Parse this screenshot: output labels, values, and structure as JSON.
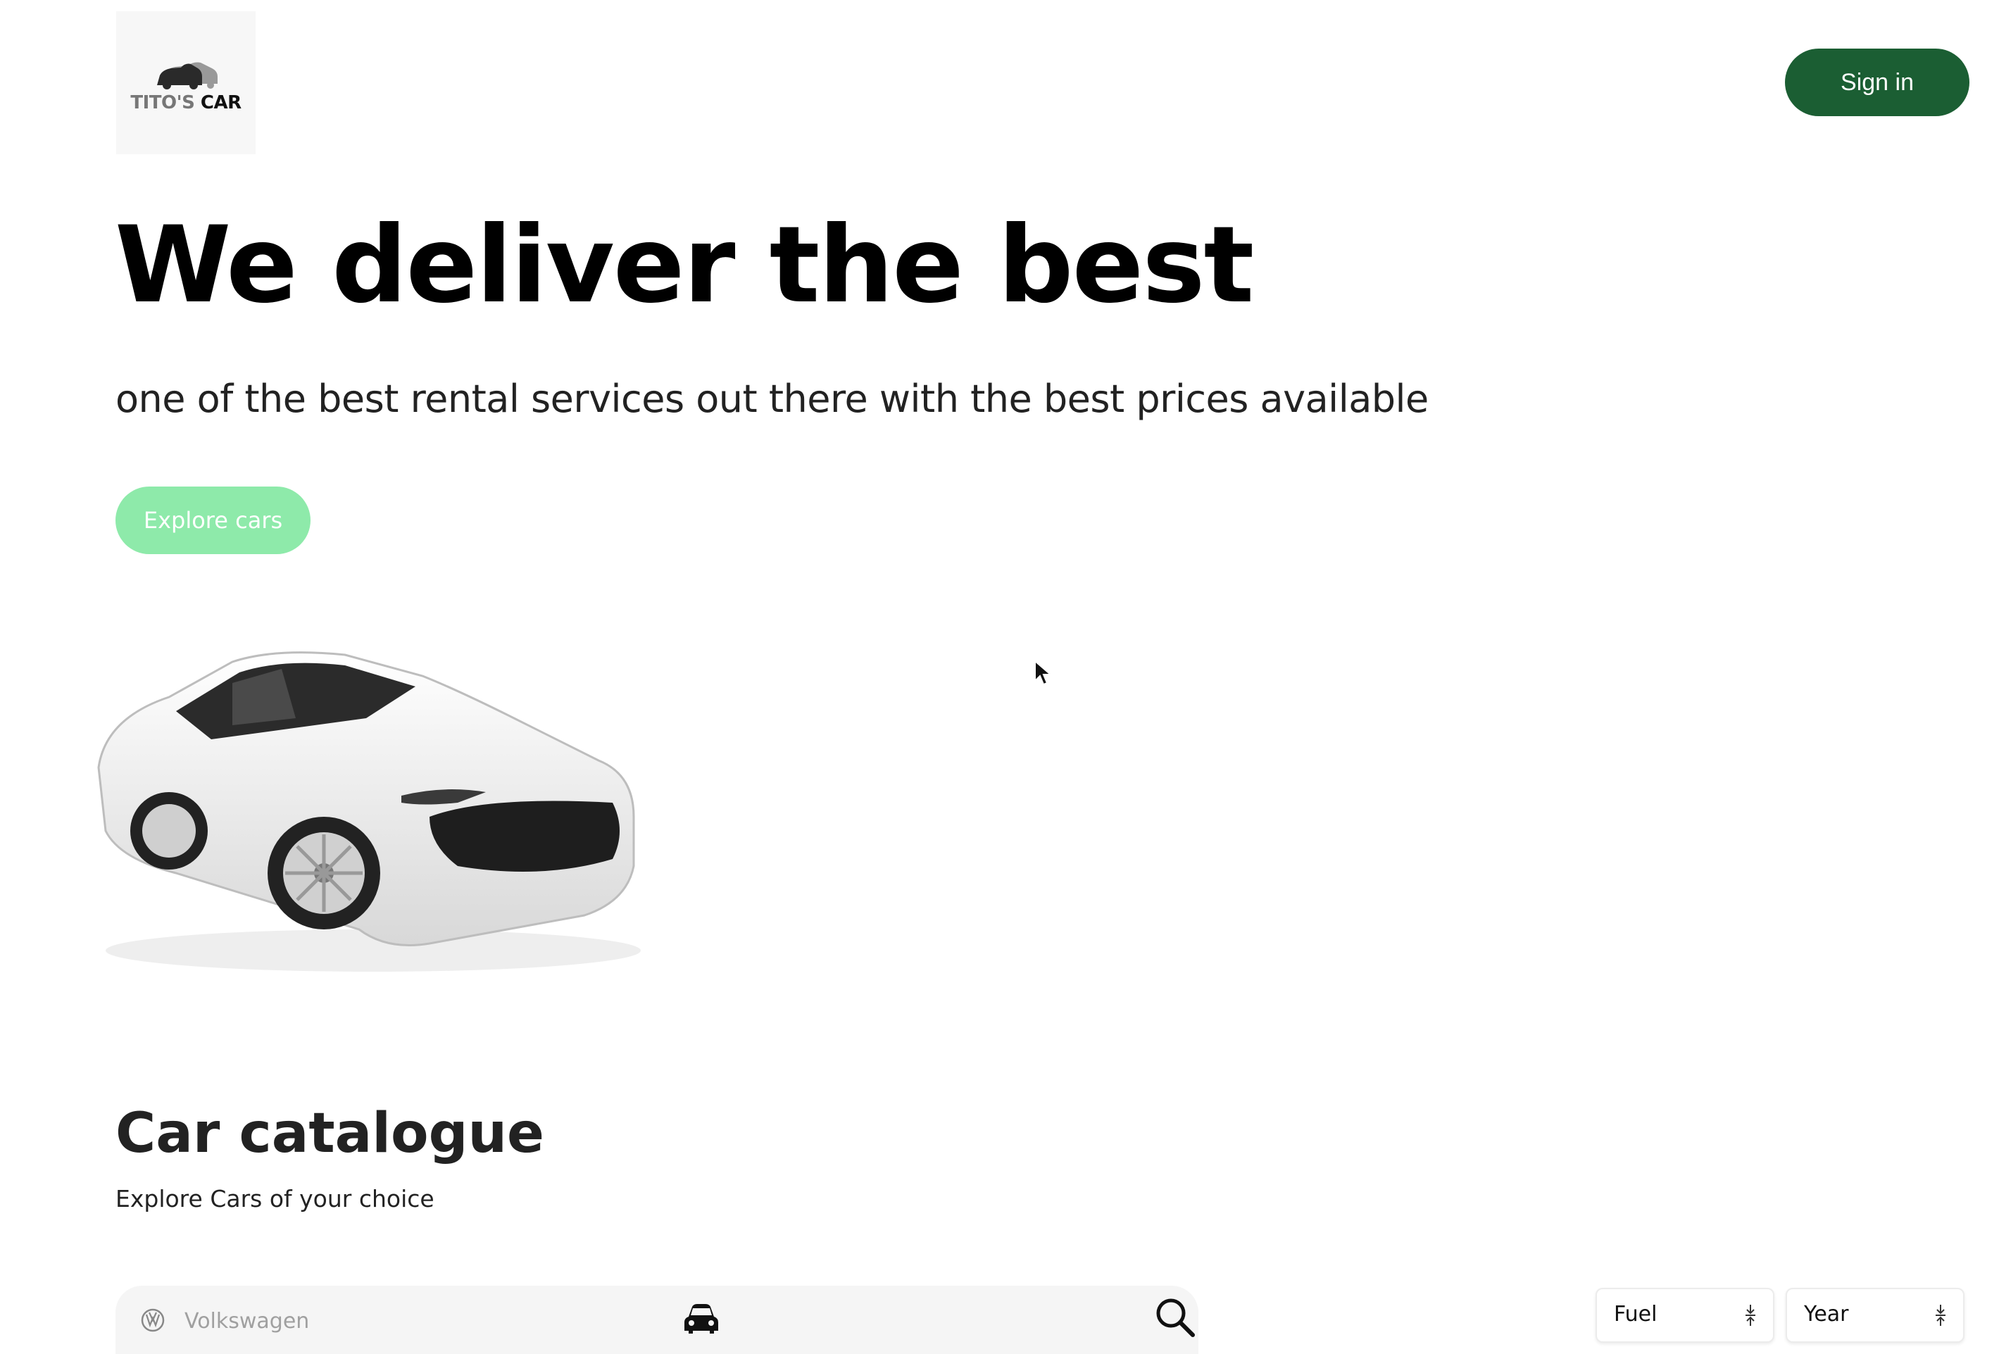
{
  "header": {
    "logo_text_part1": "TITO'S",
    "logo_text_part2": "CAR",
    "signin_label": "Sign in"
  },
  "hero": {
    "title": "We deliver the best",
    "subtitle": "one of the best rental services out there with the best prices available",
    "cta_label": "Explore cars"
  },
  "catalogue": {
    "title": "Car catalogue",
    "subtitle": "Explore Cars of your choice",
    "search": {
      "placeholder": "Volkswagen"
    },
    "filters": {
      "fuel_label": "Fuel",
      "year_label": "Year"
    }
  },
  "colors": {
    "primary": "#1b5e33",
    "accent": "#8eeaaa"
  },
  "icons": {
    "logo": "car-logo-icon",
    "hero_image": "white-sedan-image",
    "make": "volkswagen-icon",
    "model": "car-icon",
    "search": "search-icon",
    "select": "up-down-arrows-icon",
    "cursor": "mouse-pointer-icon"
  }
}
